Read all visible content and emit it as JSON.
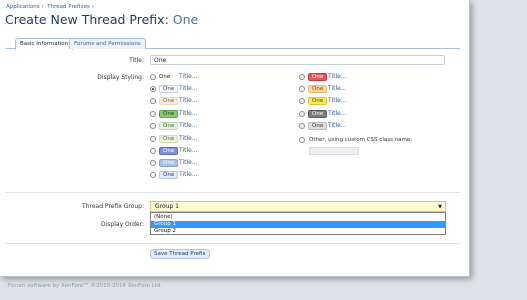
{
  "breadcrumb": [
    "Applications ›",
    "Thread Prefixes ›"
  ],
  "page_title": {
    "prefix": "Create New Thread Prefix: ",
    "name": "One"
  },
  "tabs": [
    {
      "label": "Basic Information",
      "active": true
    },
    {
      "label": "Forums and Permissions",
      "active": false
    }
  ],
  "form": {
    "title_label": "Title:",
    "title_value": "One",
    "styling_label": "Display Styling:",
    "title_link_text": "Title...",
    "styles_left": [
      {
        "text": "One",
        "kind": "plain",
        "checked": false
      },
      {
        "text": "One",
        "kind": "badge",
        "bg": "#ffffff",
        "fg": "#1e3d64",
        "border": "#c8d0da",
        "checked": true
      },
      {
        "text": "One",
        "kind": "badge",
        "bg": "#fbeee3",
        "fg": "#8a5a2b",
        "border": "#f1d7bf",
        "checked": false
      },
      {
        "text": "One",
        "kind": "badge",
        "bg": "#8cc874",
        "fg": "#1b3f10",
        "border": "#5fa34b",
        "checked": false
      },
      {
        "text": "One",
        "kind": "badge",
        "bg": "#e9f3e3",
        "fg": "#3c6b2a",
        "border": "#bfdcae",
        "checked": false
      },
      {
        "text": "One",
        "kind": "badge",
        "bg": "#eaf1dc",
        "fg": "#52702b",
        "border": "#cddfb0",
        "checked": false
      },
      {
        "text": "One",
        "kind": "badge",
        "bg": "#7f90d8",
        "fg": "#ffffff",
        "border": "#5f71bd",
        "checked": false
      },
      {
        "text": "One",
        "kind": "badge",
        "bg": "#a9c0e8",
        "fg": "#ffffff",
        "border": "#8aa4d4",
        "checked": false
      },
      {
        "text": "One",
        "kind": "badge",
        "bg": "#e3ecf6",
        "fg": "#1e3d64",
        "border": "#b7c7da",
        "checked": false
      }
    ],
    "styles_right": [
      {
        "text": "One",
        "kind": "badge",
        "bg": "#e05b5b",
        "fg": "#ffffff",
        "border": "#c24040",
        "checked": false
      },
      {
        "text": "One",
        "kind": "badge",
        "bg": "#fbd7a4",
        "fg": "#7a4a11",
        "border": "#efb86b",
        "checked": false
      },
      {
        "text": "One",
        "kind": "badge",
        "bg": "#f4e95f",
        "fg": "#5a5208",
        "border": "#d9cc33",
        "checked": false
      },
      {
        "text": "One",
        "kind": "badge",
        "bg": "#7c7c7c",
        "fg": "#ffffff",
        "border": "#5f5f5f",
        "checked": false
      },
      {
        "text": "One",
        "kind": "badge",
        "bg": "#dedede",
        "fg": "#333333",
        "border": "#bcbcbc",
        "checked": false
      }
    ],
    "custom_label": "Other, using custom CSS class name:",
    "group_label": "Thread Prefix Group:",
    "group_value": "Group 1",
    "group_options": [
      "(None)",
      "Group 1",
      "Group 2"
    ],
    "group_selected_index": 1,
    "order_label": "Display Order:",
    "save_label": "Save Thread Prefix"
  },
  "footer": "Forum software by XenForo™ ©2010-2014 XenForo Ltd."
}
